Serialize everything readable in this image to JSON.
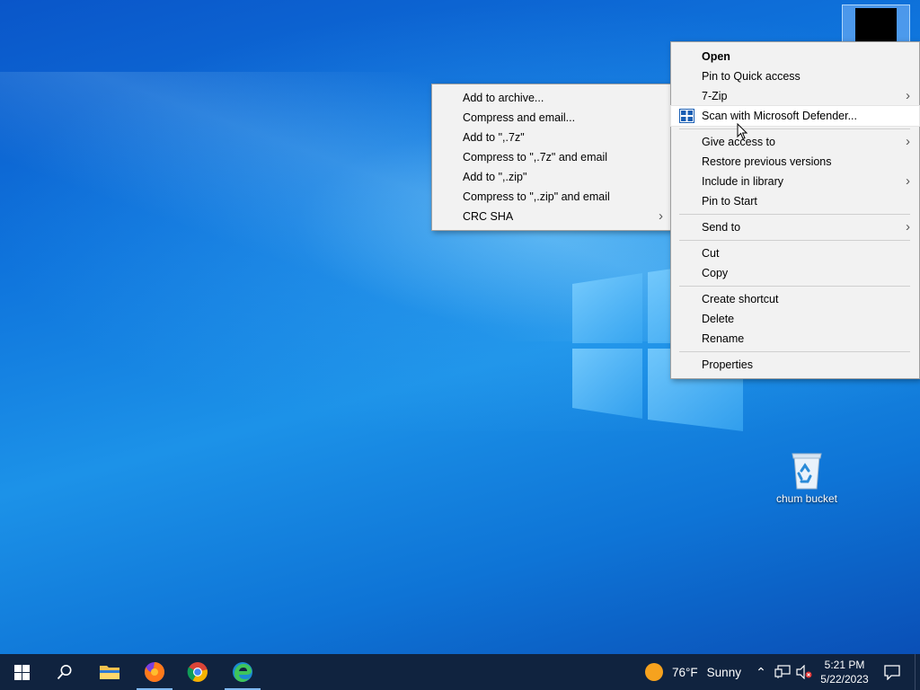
{
  "desktop": {
    "recycle_bin_label": "chum bucket"
  },
  "context_menu": {
    "items": [
      {
        "label": "Open"
      },
      {
        "label": "Pin to Quick access"
      },
      {
        "label": "7-Zip"
      },
      {
        "label": "Scan with Microsoft Defender..."
      },
      {
        "label": "Give access to"
      },
      {
        "label": "Restore previous versions"
      },
      {
        "label": "Include in library"
      },
      {
        "label": "Pin to Start"
      },
      {
        "label": "Send to"
      },
      {
        "label": "Cut"
      },
      {
        "label": "Copy"
      },
      {
        "label": "Create shortcut"
      },
      {
        "label": "Delete"
      },
      {
        "label": "Rename"
      },
      {
        "label": "Properties"
      }
    ]
  },
  "submenu_7zip": {
    "items": [
      {
        "label": "Add to archive..."
      },
      {
        "label": "Compress and email..."
      },
      {
        "label": "Add to \",.7z\""
      },
      {
        "label": "Compress to \",.7z\" and email"
      },
      {
        "label": "Add to \",.zip\""
      },
      {
        "label": "Compress to \",.zip\" and email"
      },
      {
        "label": "CRC SHA"
      }
    ]
  },
  "taskbar": {
    "weather_temp": "76°F",
    "weather_condition": "Sunny",
    "time": "5:21 PM",
    "date": "5/22/2023",
    "accent_color": "#10233f"
  }
}
